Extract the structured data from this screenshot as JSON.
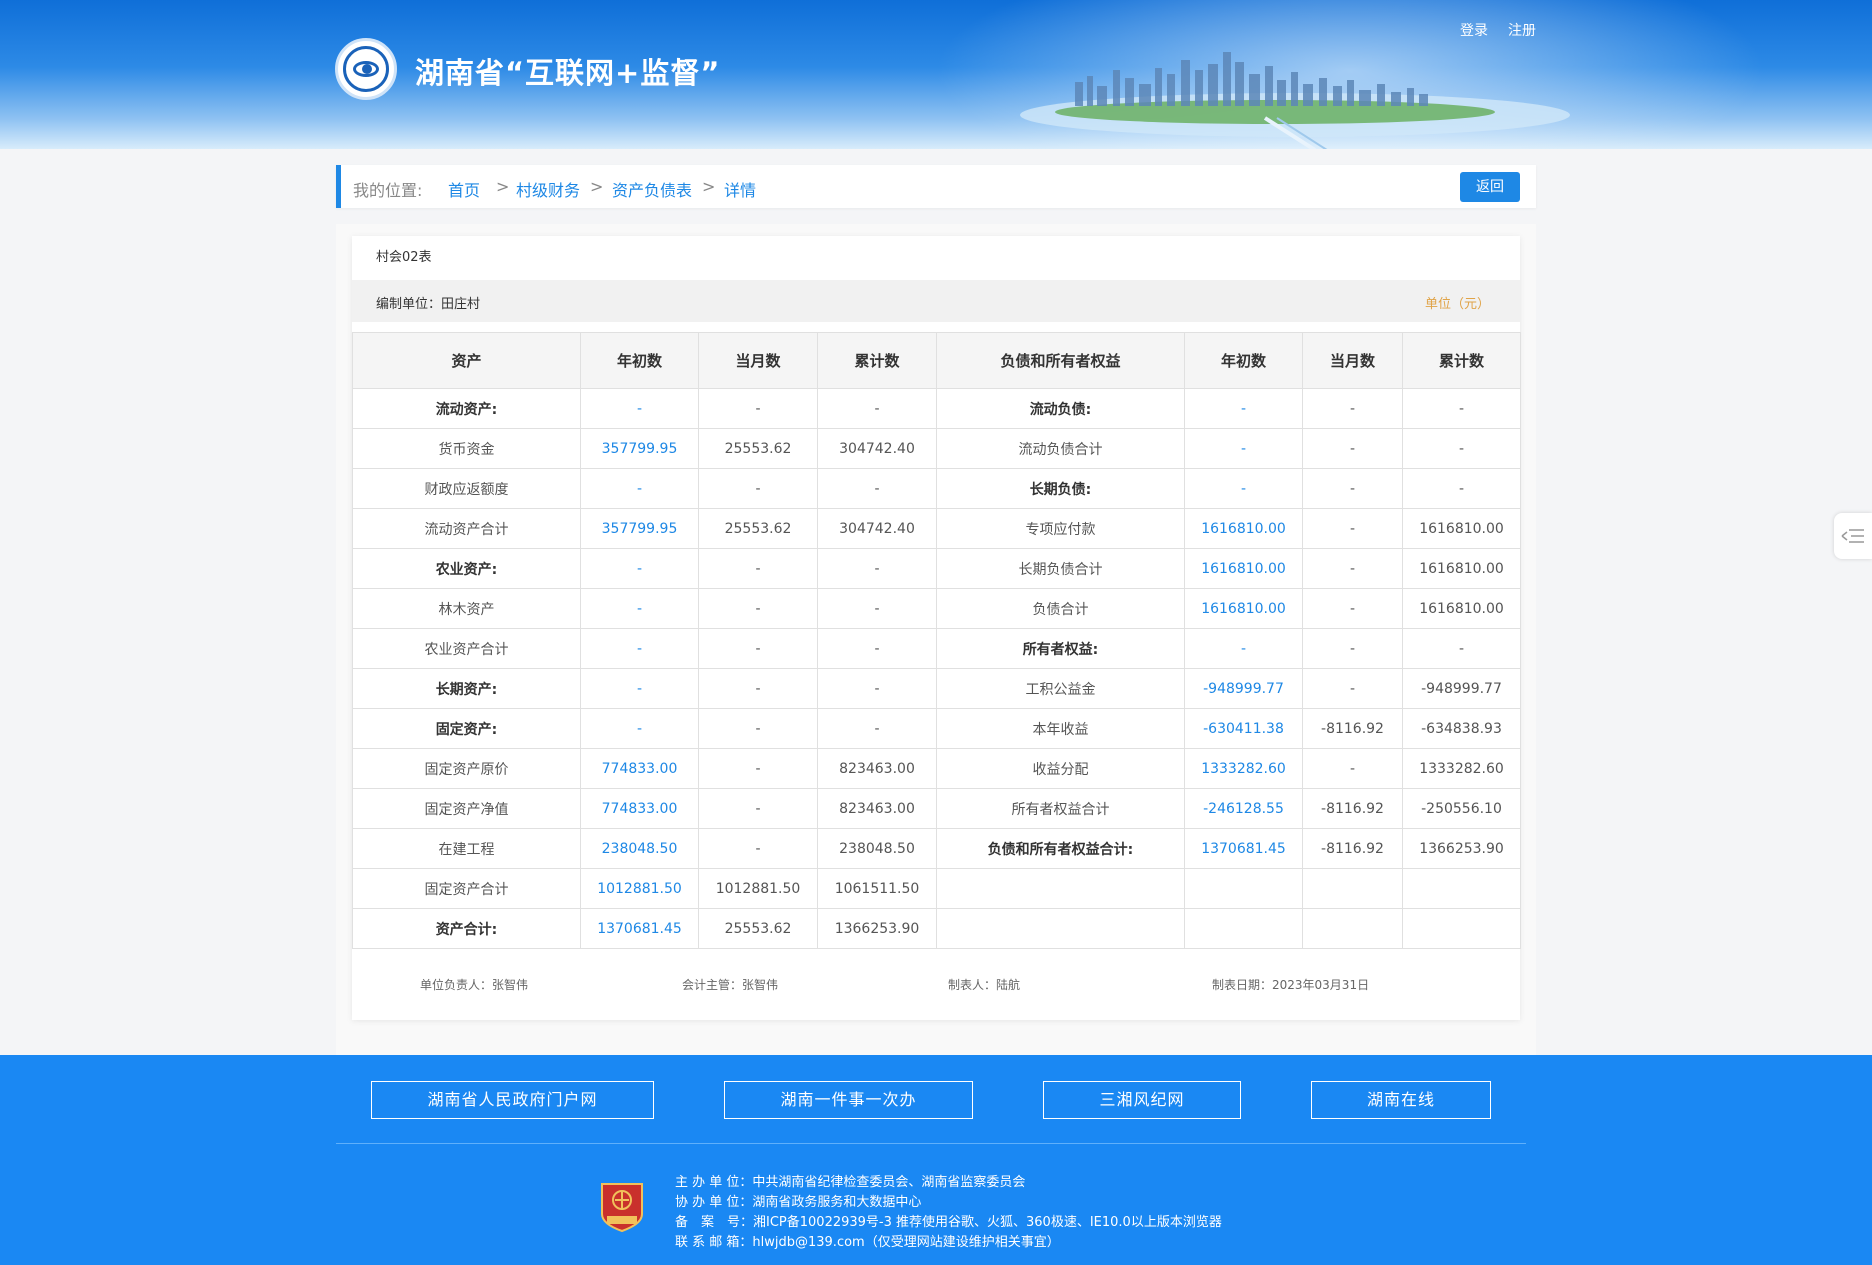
{
  "header": {
    "title": "湖南省“互联网+监督”",
    "login": "登录",
    "register": "注册"
  },
  "breadcrumb": {
    "label": "我的位置:",
    "items": [
      "首页",
      "村级财务",
      "资产负债表",
      "详情"
    ],
    "separator": ">",
    "back_button": "返回"
  },
  "report": {
    "form_no": "村会02表",
    "unit_label": "编制单位：田庄村",
    "currency": "单位（元）",
    "columns": [
      "资产",
      "年初数",
      "当月数",
      "累计数",
      "负债和所有者权益",
      "年初数",
      "当月数",
      "累计数"
    ],
    "rows": [
      {
        "asset": "流动资产:",
        "a_bold": true,
        "a1": "-",
        "a2": "-",
        "a3": "-",
        "liab": "流动负债:",
        "l_bold": true,
        "l1": "-",
        "l2": "-",
        "l3": "-"
      },
      {
        "asset": "货币资金",
        "a_bold": false,
        "a1": "357799.95",
        "a2": "25553.62",
        "a3": "304742.40",
        "liab": "流动负债合计",
        "l_bold": false,
        "l1": "-",
        "l2": "-",
        "l3": "-"
      },
      {
        "asset": "财政应返额度",
        "a_bold": false,
        "a1": "-",
        "a2": "-",
        "a3": "-",
        "liab": "长期负债:",
        "l_bold": true,
        "l1": "-",
        "l2": "-",
        "l3": "-"
      },
      {
        "asset": "流动资产合计",
        "a_bold": false,
        "a1": "357799.95",
        "a2": "25553.62",
        "a3": "304742.40",
        "liab": "专项应付款",
        "l_bold": false,
        "l1": "1616810.00",
        "l2": "-",
        "l3": "1616810.00"
      },
      {
        "asset": "农业资产:",
        "a_bold": true,
        "a1": "-",
        "a2": "-",
        "a3": "-",
        "liab": "长期负债合计",
        "l_bold": false,
        "l1": "1616810.00",
        "l2": "-",
        "l3": "1616810.00"
      },
      {
        "asset": "林木资产",
        "a_bold": false,
        "a1": "-",
        "a2": "-",
        "a3": "-",
        "liab": "负债合计",
        "l_bold": false,
        "l1": "1616810.00",
        "l2": "-",
        "l3": "1616810.00"
      },
      {
        "asset": "农业资产合计",
        "a_bold": false,
        "a1": "-",
        "a2": "-",
        "a3": "-",
        "liab": "所有者权益:",
        "l_bold": true,
        "l1": "-",
        "l2": "-",
        "l3": "-"
      },
      {
        "asset": "长期资产:",
        "a_bold": true,
        "a1": "-",
        "a2": "-",
        "a3": "-",
        "liab": "工积公益金",
        "l_bold": false,
        "l1": "-948999.77",
        "l2": "-",
        "l3": "-948999.77"
      },
      {
        "asset": "固定资产:",
        "a_bold": true,
        "a1": "-",
        "a2": "-",
        "a3": "-",
        "liab": "本年收益",
        "l_bold": false,
        "l1": "-630411.38",
        "l2": "-8116.92",
        "l3": "-634838.93"
      },
      {
        "asset": "固定资产原价",
        "a_bold": false,
        "a1": "774833.00",
        "a2": "-",
        "a3": "823463.00",
        "liab": "收益分配",
        "l_bold": false,
        "l1": "1333282.60",
        "l2": "-",
        "l3": "1333282.60"
      },
      {
        "asset": "固定资产净值",
        "a_bold": false,
        "a1": "774833.00",
        "a2": "-",
        "a3": "823463.00",
        "liab": "所有者权益合计",
        "l_bold": false,
        "l1": "-246128.55",
        "l2": "-8116.92",
        "l3": "-250556.10"
      },
      {
        "asset": "在建工程",
        "a_bold": false,
        "a1": "238048.50",
        "a2": "-",
        "a3": "238048.50",
        "liab": "负债和所有者权益合计:",
        "l_bold": true,
        "l1": "1370681.45",
        "l2": "-8116.92",
        "l3": "1366253.90"
      },
      {
        "asset": "固定资产合计",
        "a_bold": false,
        "a1": "1012881.50",
        "a2": "1012881.50",
        "a3": "1061511.50",
        "liab": "",
        "l_bold": false,
        "l1": "",
        "l2": "",
        "l3": ""
      },
      {
        "asset": "资产合计:",
        "a_bold": true,
        "a1": "1370681.45",
        "a2": "25553.62",
        "a3": "1366253.90",
        "liab": "",
        "l_bold": false,
        "l1": "",
        "l2": "",
        "l3": ""
      }
    ],
    "signatures": {
      "head": "单位负责人：张智伟",
      "accountant": "会计主管：张智伟",
      "preparer": "制表人：陆航",
      "date": "制表日期：2023年03月31日"
    }
  },
  "footer": {
    "links": [
      "湖南省人民政府门户网",
      "湖南一件事一次办",
      "三湘风纪网",
      "湖南在线"
    ],
    "sponsor": "主 办 单 位：中共湖南省纪律检查委员会、湖南省监察委员会",
    "co_sponsor": "协 办 单 位：湖南省政务服务和大数据中心",
    "icp": "备　案　号：湘ICP备10022939号-3   推荐使用谷歌、火狐、360极速、IE10.0以上版本浏览器",
    "email": "联 系 邮 箱：hlwjdb@139.com（仅受理网站建设维护相关事宜）",
    "badge_text": "党政机关"
  },
  "colors": {
    "accent": "#1e88e5",
    "footer_bg": "#1a88f3",
    "currency": "#e0a347"
  }
}
